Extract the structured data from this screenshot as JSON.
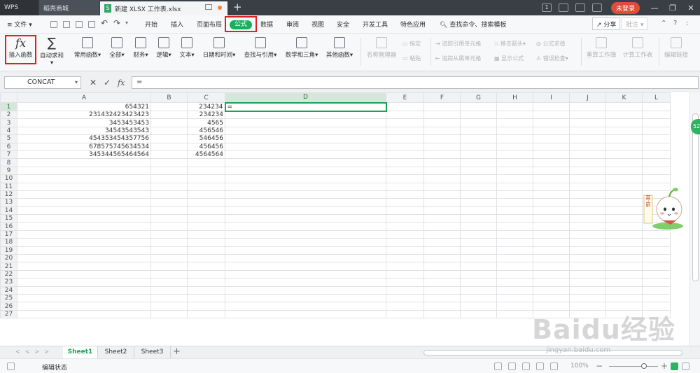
{
  "titlebar": {
    "wps_tab": "WPS",
    "store_tab": "稻壳商城",
    "file_tab": "新建 XLSX 工作表.xlsx",
    "file_badge": "S",
    "add_tab": "+",
    "badge_count": "1",
    "login": "未登录"
  },
  "menubar": {
    "file": "文件",
    "items": [
      "开始",
      "插入",
      "页面布局",
      "公式",
      "数据",
      "审阅",
      "视图",
      "安全",
      "开发工具",
      "特色应用"
    ],
    "search": "查找命令、搜索模板",
    "share": "分享",
    "comment": "批注"
  },
  "ribbon": {
    "insert_function": "插入函数",
    "fx_glyph": "fx",
    "sigma_glyph": "∑",
    "buttons": [
      "自动求和",
      "常用函数",
      "全部",
      "财务",
      "逻辑",
      "文本",
      "日期和时间",
      "查找与引用",
      "数学和三角",
      "其他函数"
    ],
    "disabled_buttons": [
      "名称管理器",
      "粘贴",
      "指定",
      "追踪引用单元格",
      "追踪从属单元格",
      "移去箭头",
      "显示公式",
      "公式求值",
      "错误检查",
      "重算工作簿",
      "计算工作表",
      "编辑链接"
    ]
  },
  "formula_bar": {
    "name_box": "CONCAT",
    "input": "="
  },
  "grid": {
    "columns": [
      "A",
      "B",
      "C",
      "D",
      "E",
      "F",
      "G",
      "H",
      "I",
      "J",
      "K",
      "L"
    ],
    "rows": [
      {
        "n": "1",
        "A": "654321",
        "C": "234234",
        "D": "="
      },
      {
        "n": "2",
        "A": "231432423423423",
        "C": "234234",
        "D": ""
      },
      {
        "n": "3",
        "A": "3453453453",
        "C": "4565",
        "D": ""
      },
      {
        "n": "4",
        "A": "34543543543",
        "C": "456546",
        "D": ""
      },
      {
        "n": "5",
        "A": "454353454357756",
        "C": "546456",
        "D": ""
      },
      {
        "n": "6",
        "A": "678575745634534",
        "C": "456456",
        "D": ""
      },
      {
        "n": "7",
        "A": "345344565464564",
        "C": "4564564",
        "D": ""
      },
      {
        "n": "8"
      },
      {
        "n": "9"
      },
      {
        "n": "10"
      },
      {
        "n": "11"
      },
      {
        "n": "12"
      },
      {
        "n": "13"
      },
      {
        "n": "14"
      },
      {
        "n": "15"
      },
      {
        "n": "16"
      },
      {
        "n": "17"
      },
      {
        "n": "18"
      },
      {
        "n": "19"
      },
      {
        "n": "20"
      },
      {
        "n": "21"
      },
      {
        "n": "22"
      },
      {
        "n": "23"
      },
      {
        "n": "24"
      },
      {
        "n": "25"
      },
      {
        "n": "26"
      },
      {
        "n": "27"
      }
    ]
  },
  "sheets": [
    "Sheet1",
    "Sheet2",
    "Sheet3"
  ],
  "status": {
    "mode": "编辑状态",
    "zoom": "100%",
    "zoom_level": 1.0
  },
  "side_badge": "52",
  "mascot_text": "英·箭",
  "watermark": {
    "logo": "Baidu经验",
    "url": "jingyan.baidu.com"
  },
  "colors": {
    "accent": "#1bae5c",
    "highlight": "#e02020",
    "login": "#e24a3b"
  }
}
